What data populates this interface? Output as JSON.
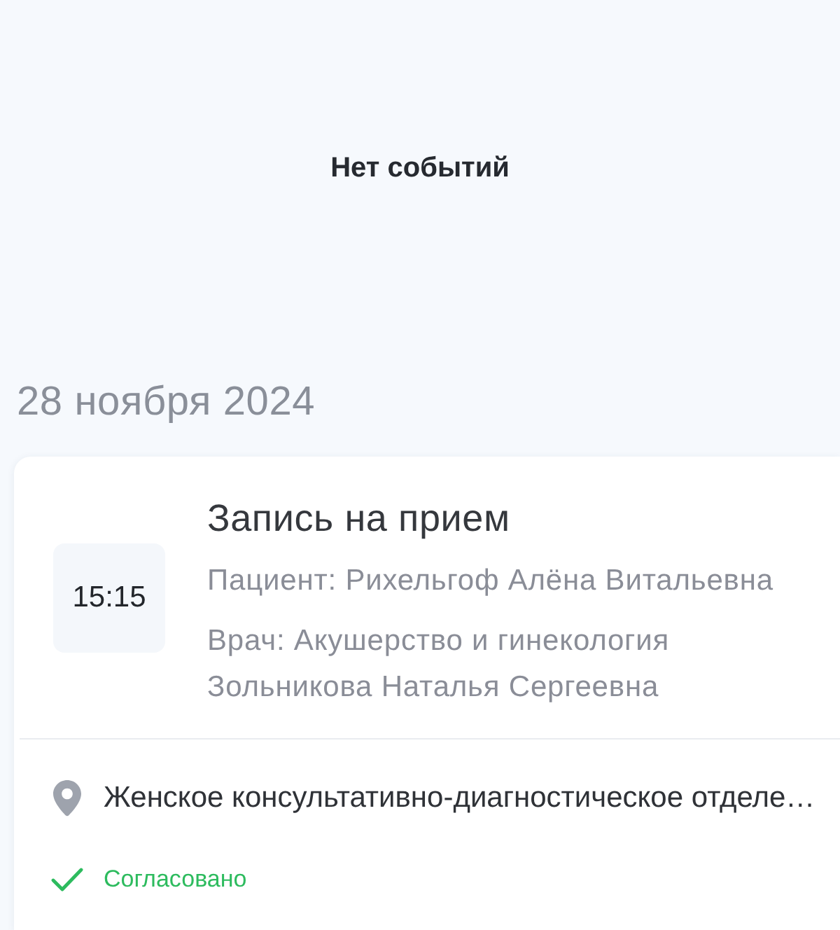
{
  "empty_state": {
    "text": "Нет событий"
  },
  "days": [
    {
      "date": "28 ноября 2024",
      "events": [
        {
          "time": "15:15",
          "title": "Запись на прием",
          "patient": "Пациент: Рихельгоф Алёна Витальевна",
          "doctor_specialty": "Врач: Акушерство и гинекология",
          "doctor_name": "Зольникова Наталья Сергеевна",
          "location": "Женское консультативно-диагностическое отделе…",
          "status": {
            "kind": "approved",
            "label": "Согласовано"
          }
        }
      ]
    }
  ]
}
